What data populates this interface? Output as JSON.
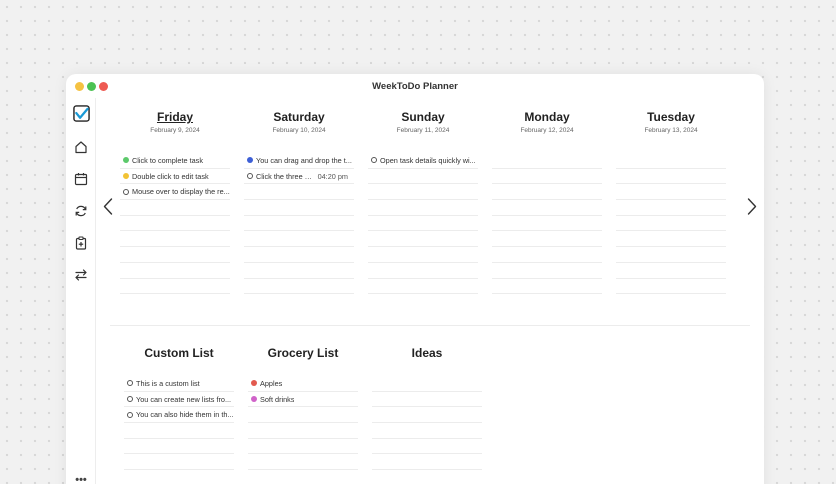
{
  "window": {
    "title": "WeekToDo Planner",
    "traffic_lights": [
      "#f5c242",
      "#4cc253",
      "#ee5a52"
    ]
  },
  "sidebar": {
    "items": [
      {
        "icon": "logo-icon"
      },
      {
        "icon": "home-icon"
      },
      {
        "icon": "calendar-icon"
      },
      {
        "icon": "sync-icon"
      },
      {
        "icon": "clipboard-icon"
      },
      {
        "icon": "swap-icon"
      }
    ],
    "more_label": "•••"
  },
  "colors": {
    "green": "#5cc96b",
    "yellow": "#f2c335",
    "blue": "#3d5fd6",
    "red": "#e25a4f",
    "pink": "#d063c9",
    "accent": "#1a9ad6"
  },
  "days": [
    {
      "name": "Friday",
      "date": "February 9, 2024",
      "today": true,
      "tasks": [
        {
          "text": "Click to complete task",
          "color": "#5cc96b"
        },
        {
          "text": "Double click to edit task",
          "color": "#f2c335"
        },
        {
          "text": "Mouse over to display the re...",
          "color": ""
        }
      ]
    },
    {
      "name": "Saturday",
      "date": "February 10, 2024",
      "today": false,
      "tasks": [
        {
          "text": "You can drag and drop the t...",
          "color": "#3d5fd6"
        },
        {
          "text": "Click the three do...",
          "color": "",
          "time": "04:20 pm"
        }
      ]
    },
    {
      "name": "Sunday",
      "date": "February 11, 2024",
      "today": false,
      "tasks": [
        {
          "text": "Open task details quickly wi...",
          "color": ""
        }
      ]
    },
    {
      "name": "Monday",
      "date": "February 12, 2024",
      "today": false,
      "tasks": []
    },
    {
      "name": "Tuesday",
      "date": "February 13, 2024",
      "today": false,
      "tasks": []
    }
  ],
  "custom_lists": [
    {
      "name": "Custom List",
      "tasks": [
        {
          "text": "This is a custom list",
          "color": ""
        },
        {
          "text": "You can create new lists fro...",
          "color": ""
        },
        {
          "text": "You can also hide them in th...",
          "color": ""
        }
      ]
    },
    {
      "name": "Grocery List",
      "tasks": [
        {
          "text": "Apples",
          "color": "#e25a4f"
        },
        {
          "text": "Soft drinks",
          "color": "#d063c9"
        }
      ]
    },
    {
      "name": "Ideas",
      "tasks": []
    }
  ]
}
